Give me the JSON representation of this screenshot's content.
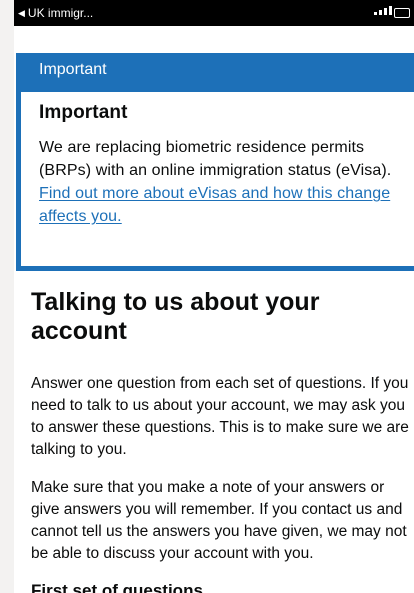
{
  "statusbar": {
    "back_label": "UK immigr..."
  },
  "banner": {
    "header_label": "Important",
    "heading": "Important",
    "text": "We are replacing biometric residence permits (BRPs) with an online immigration status (eVisa).",
    "link_text": "Find out more about eVisas and how this change affects you."
  },
  "main": {
    "title": "Talking to us about your account",
    "paragraph_1": "Answer one question from each set of questions. If you need to talk to us about your account, we may ask you to answer these questions. This is to make sure we are talking to you.",
    "paragraph_2": "Make sure that you make a note of your answers or give answers you will remember. If you contact us and cannot tell us the answers you have given, we may not be able to discuss your account with you.",
    "section_heading": "First set of questions"
  },
  "colors": {
    "brand_blue": "#1d70b8",
    "text": "#0b0c0c",
    "page_bg": "#ffffff",
    "outer_bg": "#f3f2f1"
  }
}
